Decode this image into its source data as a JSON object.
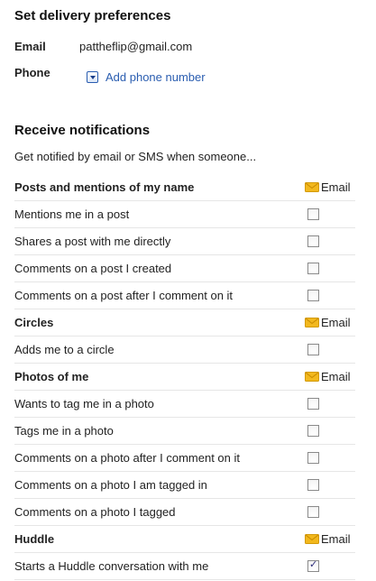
{
  "delivery": {
    "title": "Set delivery preferences",
    "email_label": "Email",
    "email_value": "pattheflip@gmail.com",
    "phone_label": "Phone",
    "add_phone": "Add phone number"
  },
  "notifications": {
    "title": "Receive notifications",
    "intro": "Get notified by email or SMS when someone...",
    "column_label": "Email",
    "groups": [
      {
        "name": "Posts and mentions of my name",
        "items": [
          {
            "label": "Mentions me in a post",
            "checked": false
          },
          {
            "label": "Shares a post with me directly",
            "checked": false
          },
          {
            "label": "Comments on a post I created",
            "checked": false
          },
          {
            "label": "Comments on a post after I comment on it",
            "checked": false
          }
        ]
      },
      {
        "name": "Circles",
        "items": [
          {
            "label": "Adds me to a circle",
            "checked": false
          }
        ]
      },
      {
        "name": "Photos of me",
        "items": [
          {
            "label": "Wants to tag me in a photo",
            "checked": false
          },
          {
            "label": "Tags me in a photo",
            "checked": false
          },
          {
            "label": "Comments on a photo after I comment on it",
            "checked": false
          },
          {
            "label": "Comments on a photo I am tagged in",
            "checked": false
          },
          {
            "label": "Comments on a photo I tagged",
            "checked": false
          }
        ]
      },
      {
        "name": "Huddle",
        "items": [
          {
            "label": "Starts a Huddle conversation with me",
            "checked": true
          }
        ]
      }
    ]
  },
  "colors": {
    "link": "#2a5db0",
    "envelope": "#f2b81d",
    "divider": "#e6e6e6"
  },
  "icons": {
    "email": "envelope-icon",
    "dropdown": "dropdown-arrow-icon"
  }
}
